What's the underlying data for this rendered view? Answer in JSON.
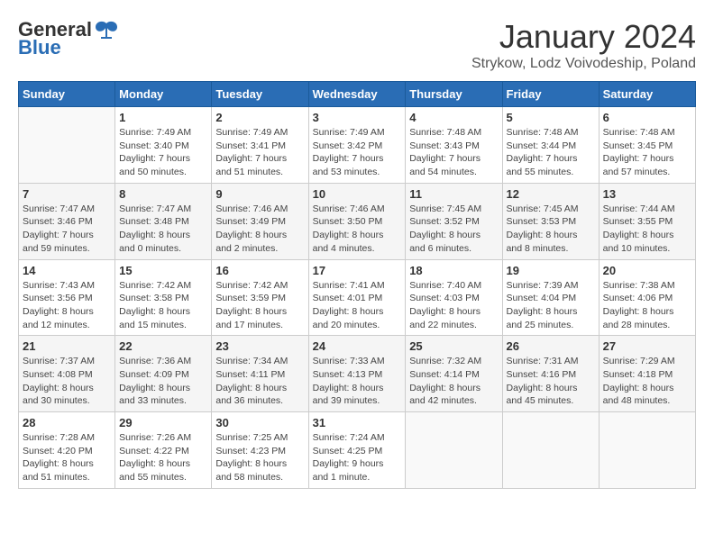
{
  "logo": {
    "general": "General",
    "blue": "Blue"
  },
  "header": {
    "title": "January 2024",
    "subtitle": "Strykow, Lodz Voivodeship, Poland"
  },
  "weekdays": [
    "Sunday",
    "Monday",
    "Tuesday",
    "Wednesday",
    "Thursday",
    "Friday",
    "Saturday"
  ],
  "weeks": [
    [
      {
        "day": "",
        "info": ""
      },
      {
        "day": "1",
        "info": "Sunrise: 7:49 AM\nSunset: 3:40 PM\nDaylight: 7 hours\nand 50 minutes."
      },
      {
        "day": "2",
        "info": "Sunrise: 7:49 AM\nSunset: 3:41 PM\nDaylight: 7 hours\nand 51 minutes."
      },
      {
        "day": "3",
        "info": "Sunrise: 7:49 AM\nSunset: 3:42 PM\nDaylight: 7 hours\nand 53 minutes."
      },
      {
        "day": "4",
        "info": "Sunrise: 7:48 AM\nSunset: 3:43 PM\nDaylight: 7 hours\nand 54 minutes."
      },
      {
        "day": "5",
        "info": "Sunrise: 7:48 AM\nSunset: 3:44 PM\nDaylight: 7 hours\nand 55 minutes."
      },
      {
        "day": "6",
        "info": "Sunrise: 7:48 AM\nSunset: 3:45 PM\nDaylight: 7 hours\nand 57 minutes."
      }
    ],
    [
      {
        "day": "7",
        "info": "Sunrise: 7:47 AM\nSunset: 3:46 PM\nDaylight: 7 hours\nand 59 minutes."
      },
      {
        "day": "8",
        "info": "Sunrise: 7:47 AM\nSunset: 3:48 PM\nDaylight: 8 hours\nand 0 minutes."
      },
      {
        "day": "9",
        "info": "Sunrise: 7:46 AM\nSunset: 3:49 PM\nDaylight: 8 hours\nand 2 minutes."
      },
      {
        "day": "10",
        "info": "Sunrise: 7:46 AM\nSunset: 3:50 PM\nDaylight: 8 hours\nand 4 minutes."
      },
      {
        "day": "11",
        "info": "Sunrise: 7:45 AM\nSunset: 3:52 PM\nDaylight: 8 hours\nand 6 minutes."
      },
      {
        "day": "12",
        "info": "Sunrise: 7:45 AM\nSunset: 3:53 PM\nDaylight: 8 hours\nand 8 minutes."
      },
      {
        "day": "13",
        "info": "Sunrise: 7:44 AM\nSunset: 3:55 PM\nDaylight: 8 hours\nand 10 minutes."
      }
    ],
    [
      {
        "day": "14",
        "info": "Sunrise: 7:43 AM\nSunset: 3:56 PM\nDaylight: 8 hours\nand 12 minutes."
      },
      {
        "day": "15",
        "info": "Sunrise: 7:42 AM\nSunset: 3:58 PM\nDaylight: 8 hours\nand 15 minutes."
      },
      {
        "day": "16",
        "info": "Sunrise: 7:42 AM\nSunset: 3:59 PM\nDaylight: 8 hours\nand 17 minutes."
      },
      {
        "day": "17",
        "info": "Sunrise: 7:41 AM\nSunset: 4:01 PM\nDaylight: 8 hours\nand 20 minutes."
      },
      {
        "day": "18",
        "info": "Sunrise: 7:40 AM\nSunset: 4:03 PM\nDaylight: 8 hours\nand 22 minutes."
      },
      {
        "day": "19",
        "info": "Sunrise: 7:39 AM\nSunset: 4:04 PM\nDaylight: 8 hours\nand 25 minutes."
      },
      {
        "day": "20",
        "info": "Sunrise: 7:38 AM\nSunset: 4:06 PM\nDaylight: 8 hours\nand 28 minutes."
      }
    ],
    [
      {
        "day": "21",
        "info": "Sunrise: 7:37 AM\nSunset: 4:08 PM\nDaylight: 8 hours\nand 30 minutes."
      },
      {
        "day": "22",
        "info": "Sunrise: 7:36 AM\nSunset: 4:09 PM\nDaylight: 8 hours\nand 33 minutes."
      },
      {
        "day": "23",
        "info": "Sunrise: 7:34 AM\nSunset: 4:11 PM\nDaylight: 8 hours\nand 36 minutes."
      },
      {
        "day": "24",
        "info": "Sunrise: 7:33 AM\nSunset: 4:13 PM\nDaylight: 8 hours\nand 39 minutes."
      },
      {
        "day": "25",
        "info": "Sunrise: 7:32 AM\nSunset: 4:14 PM\nDaylight: 8 hours\nand 42 minutes."
      },
      {
        "day": "26",
        "info": "Sunrise: 7:31 AM\nSunset: 4:16 PM\nDaylight: 8 hours\nand 45 minutes."
      },
      {
        "day": "27",
        "info": "Sunrise: 7:29 AM\nSunset: 4:18 PM\nDaylight: 8 hours\nand 48 minutes."
      }
    ],
    [
      {
        "day": "28",
        "info": "Sunrise: 7:28 AM\nSunset: 4:20 PM\nDaylight: 8 hours\nand 51 minutes."
      },
      {
        "day": "29",
        "info": "Sunrise: 7:26 AM\nSunset: 4:22 PM\nDaylight: 8 hours\nand 55 minutes."
      },
      {
        "day": "30",
        "info": "Sunrise: 7:25 AM\nSunset: 4:23 PM\nDaylight: 8 hours\nand 58 minutes."
      },
      {
        "day": "31",
        "info": "Sunrise: 7:24 AM\nSunset: 4:25 PM\nDaylight: 9 hours\nand 1 minute."
      },
      {
        "day": "",
        "info": ""
      },
      {
        "day": "",
        "info": ""
      },
      {
        "day": "",
        "info": ""
      }
    ]
  ]
}
